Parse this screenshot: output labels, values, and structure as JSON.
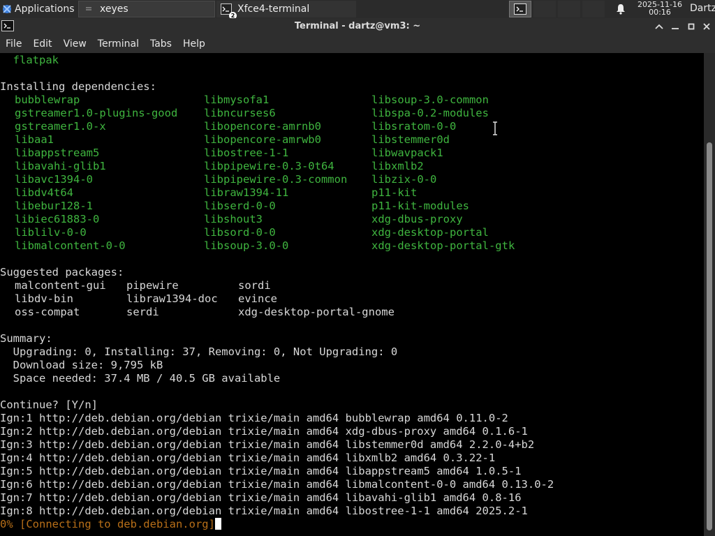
{
  "panel": {
    "apps_label": "Applications",
    "task_1": {
      "label": "xeyes"
    },
    "task_2": {
      "label": "Xfce4-terminal",
      "badge": "2"
    },
    "clock": {
      "date": "2025-11-16",
      "time": "00:16"
    },
    "user": "Dartz"
  },
  "window": {
    "title": "Terminal - dartz@vm3: ~"
  },
  "menu": [
    "File",
    "Edit",
    "View",
    "Terminal",
    "Tabs",
    "Help"
  ],
  "terminal": {
    "line_flatpak": "  flatpak",
    "deps_header": "Installing dependencies:",
    "deps_col1": [
      "bubblewrap",
      "gstreamer1.0-plugins-good",
      "gstreamer1.0-x",
      "libaa1",
      "libappstream5",
      "libavahi-glib1",
      "libavc1394-0",
      "libdv4t64",
      "libebur128-1",
      "libiec61883-0",
      "liblilv-0-0",
      "libmalcontent-0-0"
    ],
    "deps_col2": [
      "libmysofa1",
      "libncurses6",
      "libopencore-amrnb0",
      "libopencore-amrwb0",
      "libostree-1-1",
      "libpipewire-0.3-0t64",
      "libpipewire-0.3-common",
      "libraw1394-11",
      "libserd-0-0",
      "libshout3",
      "libsord-0-0",
      "libsoup-3.0-0"
    ],
    "deps_col3": [
      "libsoup-3.0-common",
      "libspa-0.2-modules",
      "libsratom-0-0",
      "libstemmer0d",
      "libwavpack1",
      "libxmlb2",
      "libzix-0-0",
      "p11-kit",
      "p11-kit-modules",
      "xdg-dbus-proxy",
      "xdg-desktop-portal",
      "xdg-desktop-portal-gtk"
    ],
    "suggested_header": "Suggested packages:",
    "suggested_col1": [
      "malcontent-gui",
      "libdv-bin",
      "oss-compat"
    ],
    "suggested_col2": [
      "pipewire",
      "libraw1394-doc",
      "serdi"
    ],
    "suggested_col3": [
      "sordi",
      "evince",
      "xdg-desktop-portal-gnome"
    ],
    "summary_header": "Summary:",
    "summary_lines": [
      "  Upgrading: 0, Installing: 37, Removing: 0, Not Upgrading: 0",
      "  Download size: 9,795 kB",
      "  Space needed: 37.4 MB / 40.5 GB available"
    ],
    "continue_prompt": "Continue? [Y/n]",
    "ign_lines": [
      "Ign:1 http://deb.debian.org/debian trixie/main amd64 bubblewrap amd64 0.11.0-2",
      "Ign:2 http://deb.debian.org/debian trixie/main amd64 xdg-dbus-proxy amd64 0.1.6-1",
      "Ign:3 http://deb.debian.org/debian trixie/main amd64 libstemmer0d amd64 2.2.0-4+b2",
      "Ign:4 http://deb.debian.org/debian trixie/main amd64 libxmlb2 amd64 0.3.22-1",
      "Ign:5 http://deb.debian.org/debian trixie/main amd64 libappstream5 amd64 1.0.5-1",
      "Ign:6 http://deb.debian.org/debian trixie/main amd64 libmalcontent-0-0 amd64 0.13.0-2",
      "Ign:7 http://deb.debian.org/debian trixie/main amd64 libavahi-glib1 amd64 0.8-16",
      "Ign:8 http://deb.debian.org/debian trixie/main amd64 libostree-1-1 amd64 2025.2-1"
    ],
    "progress_line": "0% [Connecting to deb.debian.org]"
  },
  "colors": {
    "package_green": "#3fb53f",
    "progress_orange": "#b86f18",
    "terminal_bg": "#000000",
    "panel_bg": "#2b2b2b"
  },
  "icons": {
    "apps": "xfce-mouse-icon",
    "task_1": "drag-handle-icon",
    "task_2": "terminal-icon",
    "workspace": "terminal-icon",
    "notification": "bell-icon",
    "window_controls": [
      "chevron-up-icon",
      "minimize-icon",
      "maximize-icon",
      "close-icon"
    ]
  }
}
